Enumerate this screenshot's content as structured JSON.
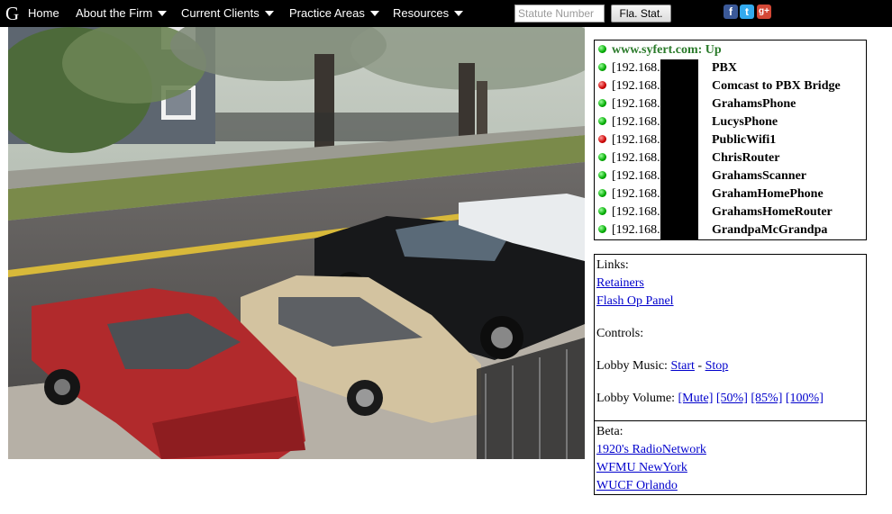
{
  "nav": {
    "logo": "G",
    "items": [
      {
        "label": "Home",
        "has_menu": false
      },
      {
        "label": "About the Firm",
        "has_menu": true
      },
      {
        "label": "Current Clients",
        "has_menu": true
      },
      {
        "label": "Practice Areas",
        "has_menu": true
      },
      {
        "label": "Resources",
        "has_menu": true
      }
    ],
    "search_placeholder": "Statute Number",
    "search_button": "Fla. Stat.",
    "social": {
      "facebook": "f",
      "twitter": "t",
      "googleplus": "g+"
    }
  },
  "colors": {
    "up": "#0a0",
    "down": "#c00",
    "site": "#2a7a2a",
    "link": "#0000cc"
  },
  "status": {
    "site": {
      "label": "www.syfert.com: Up",
      "state": "up"
    },
    "devices": [
      {
        "ip": "[192.168.",
        "name": "PBX",
        "state": "up"
      },
      {
        "ip": "[192.168.",
        "name": "Comcast to PBX Bridge",
        "state": "down"
      },
      {
        "ip": "[192.168.",
        "name": "GrahamsPhone",
        "state": "up"
      },
      {
        "ip": "[192.168.",
        "name": "LucysPhone",
        "state": "up"
      },
      {
        "ip": "[192.168.",
        "name": "PublicWifi1",
        "state": "down"
      },
      {
        "ip": "[192.168.",
        "name": "ChrisRouter",
        "state": "up"
      },
      {
        "ip": "[192.168.",
        "name": "GrahamsScanner",
        "state": "up"
      },
      {
        "ip": "[192.168.",
        "name": "GrahamHomePhone",
        "state": "up"
      },
      {
        "ip": "[192.168.",
        "name": "GrahamsHomeRouter",
        "state": "up"
      },
      {
        "ip": "[192.168.",
        "name": "GrandpaMcGrandpa",
        "state": "up"
      }
    ]
  },
  "links": {
    "heading": "Links:",
    "retainers": "Retainers",
    "flash_op": "Flash Op Panel",
    "controls_heading": "Controls:",
    "music_label": "Lobby Music:",
    "music_start": "Start",
    "music_sep": "-",
    "music_stop": "Stop",
    "volume_label": "Lobby Volume:",
    "volume_options": [
      "[Mute]",
      "[50%]",
      "[85%]",
      "[100%]"
    ]
  },
  "beta": {
    "heading": "Beta:",
    "streams": [
      "1920's RadioNetwork",
      "WFMU NewYork",
      "WUCF Orlando"
    ]
  }
}
